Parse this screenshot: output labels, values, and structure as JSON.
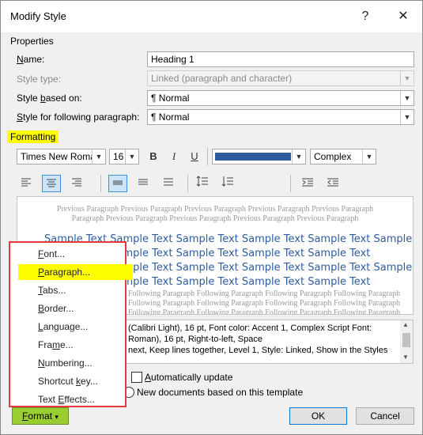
{
  "window": {
    "title": "Modify Style",
    "help_glyph": "?",
    "close_glyph": "✕"
  },
  "properties": {
    "heading": "Properties",
    "name_label": "Name:",
    "name_value": "Heading 1",
    "style_type_label": "Style type:",
    "style_type_value": "Linked (paragraph and character)",
    "based_on_label": "Style based on:",
    "based_on_value": "¶  Normal",
    "following_label": "Style for following paragraph:",
    "following_value": "¶  Normal"
  },
  "formatting": {
    "heading": "Formatting",
    "font": "Times New Roman",
    "size": "16",
    "bold": "B",
    "italic": "I",
    "underline": "U",
    "color": "#2e5c9e",
    "script": "Complex"
  },
  "preview": {
    "prev_line1": "Previous Paragraph Previous Paragraph Previous Paragraph Previous Paragraph Previous Paragraph",
    "prev_line2": "Paragraph Previous Paragraph Previous Paragraph Previous Paragraph Previous Paragraph",
    "sample_line1": "Sample Text Sample Text Sample Text Sample Text Sample Text Sample",
    "sample_line2": "Sample Text Sample Text Sample Text Sample Text Sample Text",
    "sample_line3": "Sample Text Sample Text Sample Text Sample Text Sample Text Sample",
    "sample_line4": "Sample Text Sample Text Sample Text Sample Text Sample Text",
    "follow_line1": "Following Paragraph Following Paragraph Following Paragraph Following Paragraph",
    "follow_line2": "Following Paragraph Following Paragraph Following Paragraph Following Paragraph",
    "follow_line3": "Following Paragraph Following Paragraph Following Paragraph Following Paragraph"
  },
  "description": {
    "line1": "(Calibri Light), 16 pt, Font color: Accent 1, Complex Script Font:",
    "line2": "Roman), 16 pt, Right-to-left, Space",
    "line3": "next, Keep lines together, Level 1, Style: Linked, Show in the Styles"
  },
  "options": {
    "auto_update": "Automatically update",
    "new_docs": "New documents based on this template"
  },
  "buttons": {
    "format": "Format",
    "format_caret": "▾",
    "ok": "OK",
    "cancel": "Cancel"
  },
  "format_menu": {
    "items": [
      "Font...",
      "Paragraph...",
      "Tabs...",
      "Border...",
      "Language...",
      "Frame...",
      "Numbering...",
      "Shortcut key...",
      "Text Effects..."
    ],
    "highlighted_index": 1
  }
}
